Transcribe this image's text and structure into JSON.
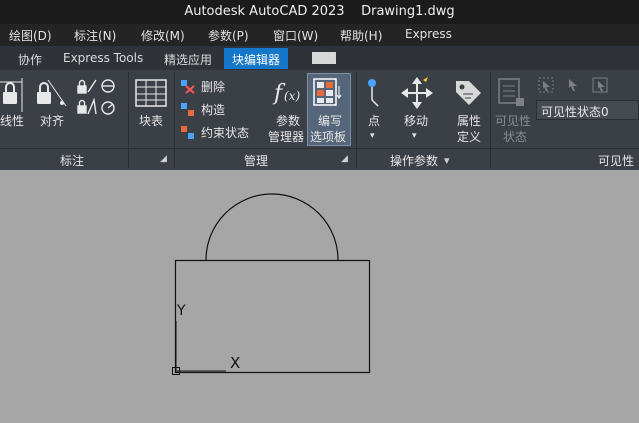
{
  "window": {
    "title": "Autodesk AutoCAD 2023    Drawing1.dwg"
  },
  "menu": [
    "绘图(D)",
    "标注(N)",
    "修改(M)",
    "参数(P)",
    "窗口(W)",
    "帮助(H)",
    "Express"
  ],
  "tabs": [
    "协作",
    "Express Tools",
    "精选应用",
    "块编辑器"
  ],
  "active_tab": "块编辑器",
  "ribbon": {
    "dimension": {
      "items": {
        "linear": "线性",
        "aligned": "对齐"
      },
      "group_label": "标注"
    },
    "table": {
      "label": "块表"
    },
    "manage": {
      "delete": "删除",
      "construct": "构造",
      "constraint_status": "约束状态",
      "param_manager_l1": "参数",
      "param_manager_l2": "管理器",
      "write_palette_l1": "编写",
      "write_palette_l2": "选项板",
      "group_label": "管理"
    },
    "action_params": {
      "point": "点",
      "move": "移动",
      "attr_def_l1": "属性",
      "attr_def_l2": "定义",
      "group_label": "操作参数"
    },
    "visibility": {
      "state_l1": "可见性",
      "state_l2": "状态",
      "current_state": "可见性状态0",
      "group_label": "可见性"
    }
  },
  "canvas": {
    "ucs_y": "Y",
    "ucs_x": "X"
  },
  "colors": {
    "accent": "#1477c9",
    "ribbon_bg": "#3b3f46",
    "canvas_bg": "#a6a6a6"
  }
}
